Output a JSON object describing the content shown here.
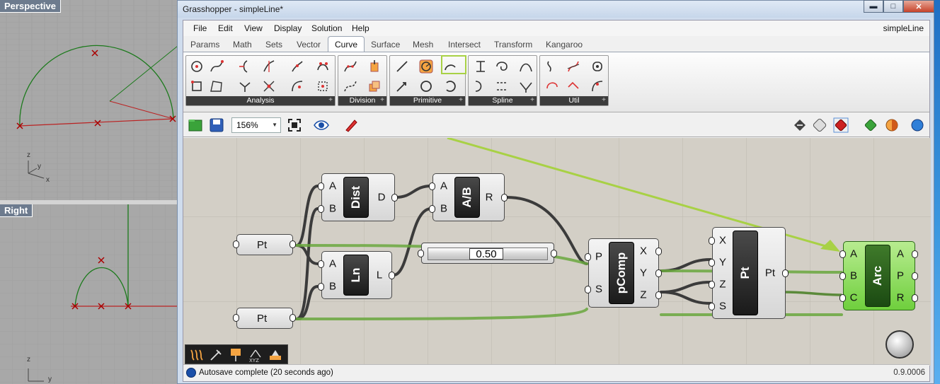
{
  "viewports": {
    "perspective": {
      "title": "Perspective",
      "axes": [
        "z",
        "y",
        "x"
      ]
    },
    "right": {
      "title": "Right",
      "axes": [
        "z",
        "y"
      ]
    }
  },
  "window": {
    "title": "Grasshopper - simpleLine*",
    "controls": {
      "minimize": "▬",
      "maximize": "□",
      "close": "✕"
    }
  },
  "menu": {
    "items": [
      "File",
      "Edit",
      "View",
      "Display",
      "Solution",
      "Help"
    ],
    "document_name": "simpleLine"
  },
  "tabs": [
    "Params",
    "Math",
    "Sets",
    "Vector",
    "Curve",
    "Surface",
    "Mesh",
    "Intersect",
    "Transform",
    "Kangaroo"
  ],
  "active_tab": "Curve",
  "ribbon": {
    "groups": [
      "Analysis",
      "Division",
      "Primitive",
      "Spline",
      "Util"
    ]
  },
  "toolbar": {
    "zoom": "156%"
  },
  "canvas": {
    "components": {
      "pt1": {
        "label": "Pt"
      },
      "pt2": {
        "label": "Pt"
      },
      "dist": {
        "name": "Dist",
        "inputs": [
          "A",
          "B"
        ],
        "outputs": [
          "D"
        ]
      },
      "ln": {
        "name": "Ln",
        "inputs": [
          "A",
          "B"
        ],
        "outputs": [
          "L"
        ]
      },
      "div": {
        "name": "A/B",
        "inputs": [
          "A",
          "B"
        ],
        "outputs": [
          "R"
        ]
      },
      "slider": {
        "value": "0.50"
      },
      "pcomp": {
        "name": "pComp",
        "inputs": [
          "P",
          "S"
        ],
        "outputs": [
          "X",
          "Y",
          "Z"
        ]
      },
      "pt": {
        "name": "Pt",
        "inputs": [
          "X",
          "Y",
          "Z",
          "S"
        ],
        "outputs": [
          "Pt"
        ]
      },
      "arc": {
        "name": "Arc",
        "inputs": [
          "A",
          "B",
          "C"
        ],
        "outputs": [
          "A",
          "P",
          "R"
        ]
      }
    }
  },
  "status": {
    "text": "Autosave complete (20 seconds ago)",
    "version": "0.9.0006"
  }
}
